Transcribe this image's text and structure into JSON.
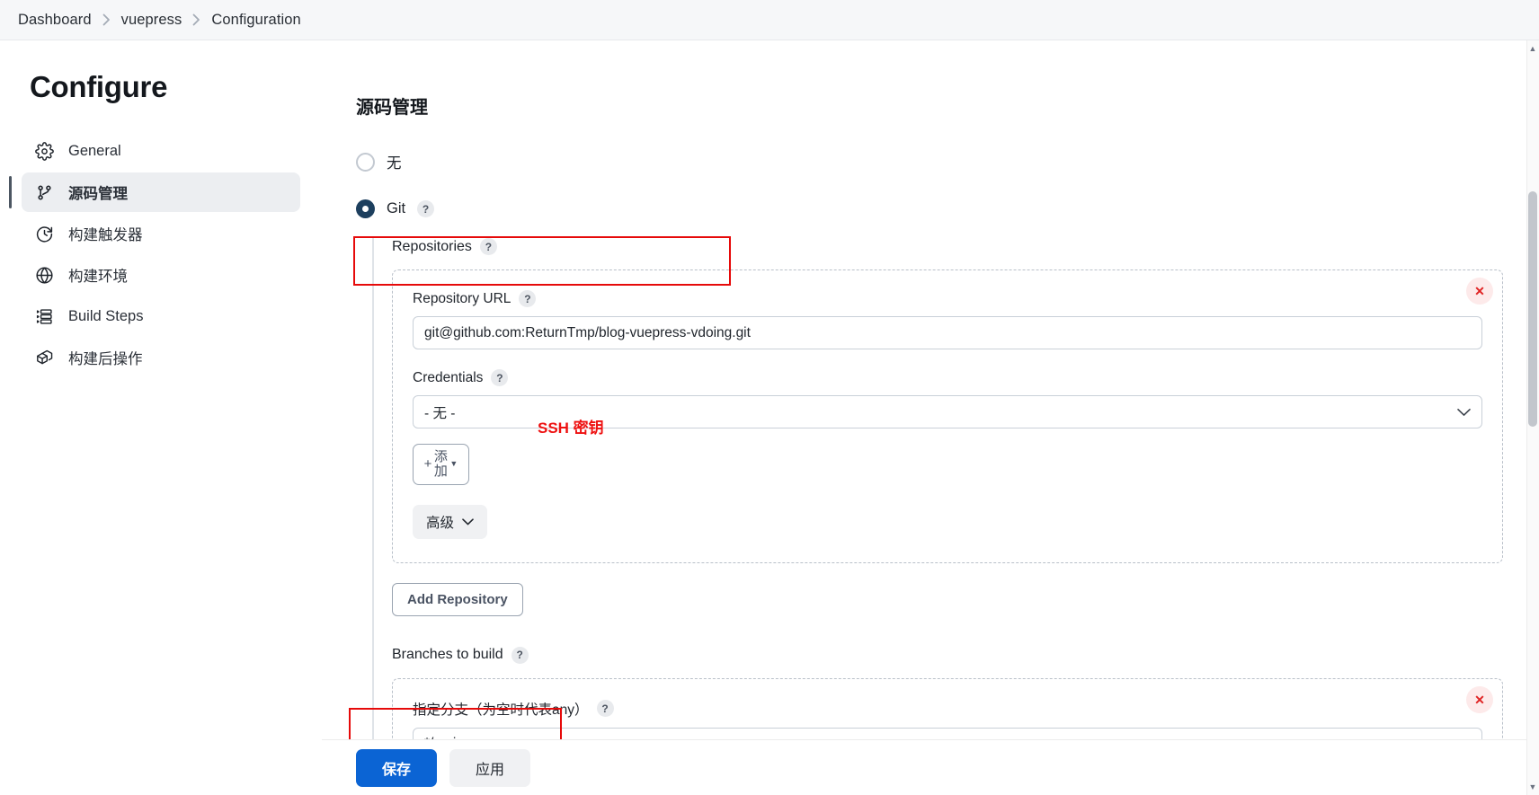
{
  "breadcrumb": {
    "items": [
      {
        "label": "Dashboard"
      },
      {
        "label": "vuepress"
      },
      {
        "label": "Configuration"
      }
    ]
  },
  "sidebar": {
    "title": "Configure",
    "items": [
      {
        "label": "General",
        "icon": "gear-icon",
        "active": false
      },
      {
        "label": "源码管理",
        "icon": "source-branch-icon",
        "active": true
      },
      {
        "label": "构建触发器",
        "icon": "clock-icon",
        "active": false
      },
      {
        "label": "构建环境",
        "icon": "globe-icon",
        "active": false
      },
      {
        "label": "Build Steps",
        "icon": "list-steps-icon",
        "active": false
      },
      {
        "label": "构建后操作",
        "icon": "boxes-icon",
        "active": false
      }
    ]
  },
  "main": {
    "section_title": "源码管理",
    "scm_options": [
      {
        "label": "无",
        "selected": false
      },
      {
        "label": "Git",
        "selected": true,
        "help": "?"
      }
    ],
    "repositories": {
      "label": "Repositories",
      "help": "?",
      "entry": {
        "url_label": "Repository URL",
        "url_help": "?",
        "url_value": "git@github.com:ReturnTmp/blog-vuepress-vdoing.git",
        "credentials_label": "Credentials",
        "credentials_help": "?",
        "credentials_value": "- 无 -",
        "add_credentials_label": "添加",
        "advanced_label": "高级",
        "delete_label": "✕"
      },
      "add_repository_label": "Add Repository"
    },
    "branches": {
      "label": "Branches to build",
      "help": "?",
      "entry": {
        "specifier_label": "指定分支（为空时代表any）",
        "specifier_help": "?",
        "specifier_value": "*/main",
        "delete_label": "✕"
      }
    },
    "annotations": [
      {
        "text": "SSH 密钥",
        "color": "#ee1111"
      }
    ]
  },
  "footer": {
    "save_label": "保存",
    "apply_label": "应用"
  },
  "colors": {
    "accent": "#0b64d4",
    "radio_selected": "#1d3f5e",
    "annotation_red": "#e60a0a",
    "sidebar_active_bg": "#eceef1"
  }
}
